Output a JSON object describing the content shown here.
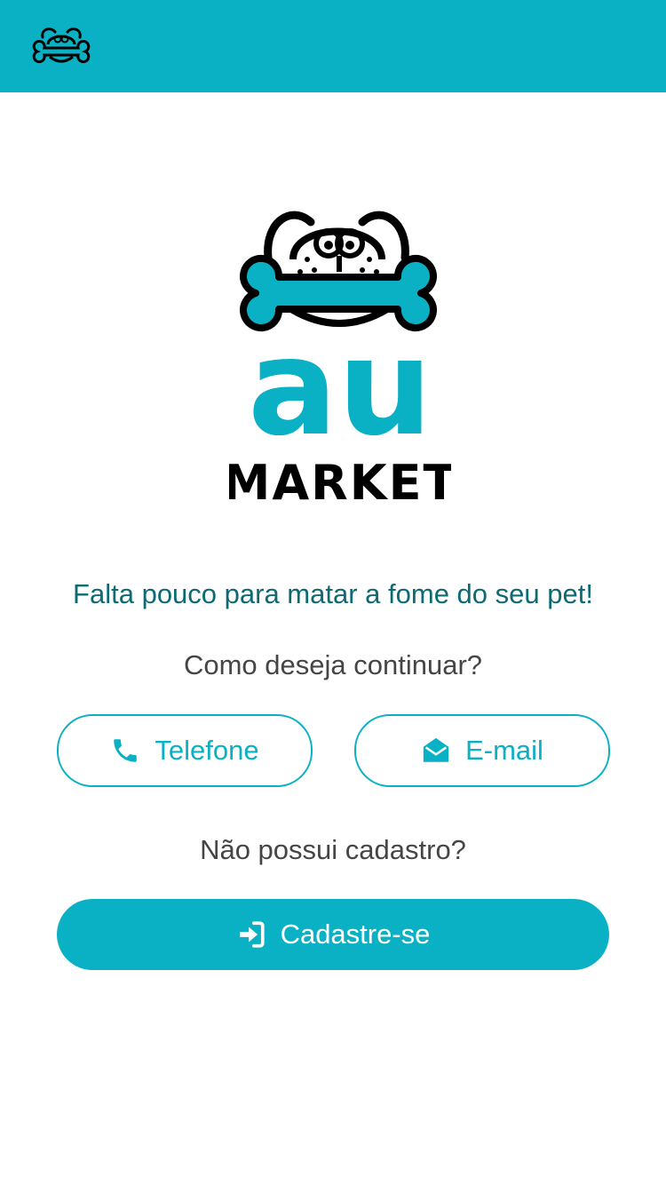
{
  "header": {
    "logo_icon": "dog-bone-logo-icon",
    "background_color": "#0ab1c4"
  },
  "logo": {
    "brand_top": "au",
    "brand_bottom": "MARKET",
    "accent_color": "#0ab1c4"
  },
  "main": {
    "tagline": "Falta pouco para matar a fome do seu pet!",
    "question": "Como deseja continuar?",
    "phone_button": {
      "label": "Telefone",
      "icon": "phone-icon"
    },
    "email_button": {
      "label": "E-mail",
      "icon": "envelope-open-icon"
    },
    "no_account_text": "Não possui cadastro?",
    "signup_button": {
      "label": "Cadastre-se",
      "icon": "sign-in-icon"
    }
  }
}
